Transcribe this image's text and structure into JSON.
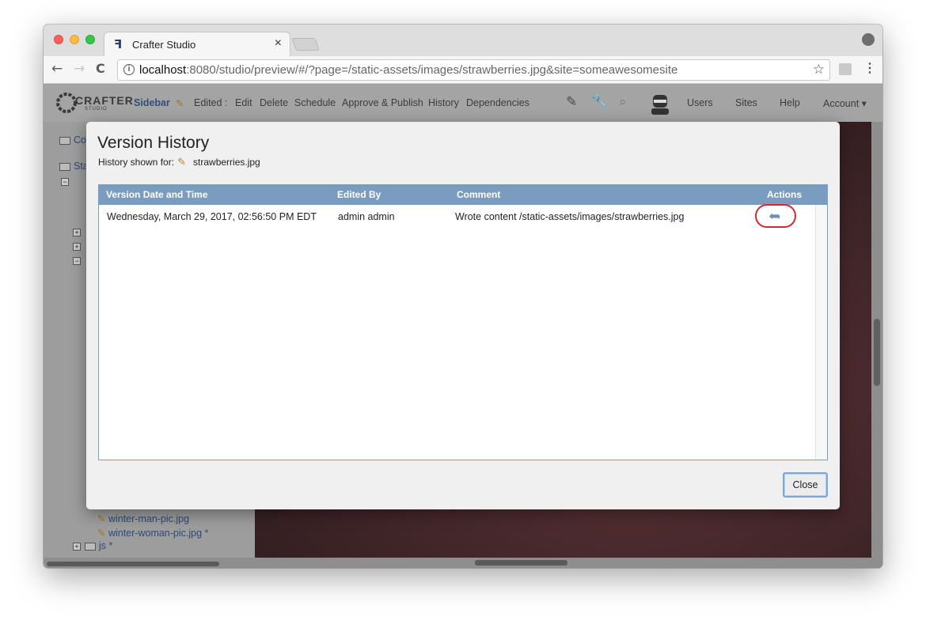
{
  "browser": {
    "tab_title": "Crafter Studio",
    "tab_close": "×",
    "url_host": "localhost",
    "url_rest": ":8080/studio/preview/#/?page=/static-assets/images/strawberries.jpg&site=someawesomesite",
    "back": "←",
    "forward": "→",
    "reload": "C",
    "bookmark": "☆",
    "menu": "⋮",
    "info": "i"
  },
  "app": {
    "logo_word": "CRAFTER",
    "logo_sub": "STUDIO",
    "sidebar_label": "Sidebar",
    "edited_label": "Edited :",
    "actions": [
      "Edit",
      "Delete",
      "Schedule",
      "Approve & Publish",
      "History",
      "Dependencies"
    ],
    "nav": [
      "Users",
      "Sites",
      "Help",
      "Account ▾"
    ]
  },
  "sidebar": {
    "rows": [
      "Co",
      "Sta",
      "winter-man-pic.jpg",
      "winter-woman-pic.jpg *",
      "js *"
    ]
  },
  "dialog": {
    "title": "Version History",
    "shown_for_label": "History shown for:",
    "file_name": "strawberries.jpg",
    "columns": [
      "Version Date and Time",
      "Edited By",
      "Comment",
      "Actions"
    ],
    "rows": [
      {
        "date": "Wednesday, March 29, 2017, 02:56:50 PM EDT",
        "edited_by": "admin admin",
        "comment": "Wrote content /static-assets/images/strawberries.jpg",
        "action_icon": "revert-icon"
      }
    ],
    "revert_glyph": "➦",
    "close_label": "Close"
  },
  "colors": {
    "table_header": "#7b9cc1",
    "highlight_ring": "#d8262d",
    "link_blue": "#2b4a78"
  }
}
